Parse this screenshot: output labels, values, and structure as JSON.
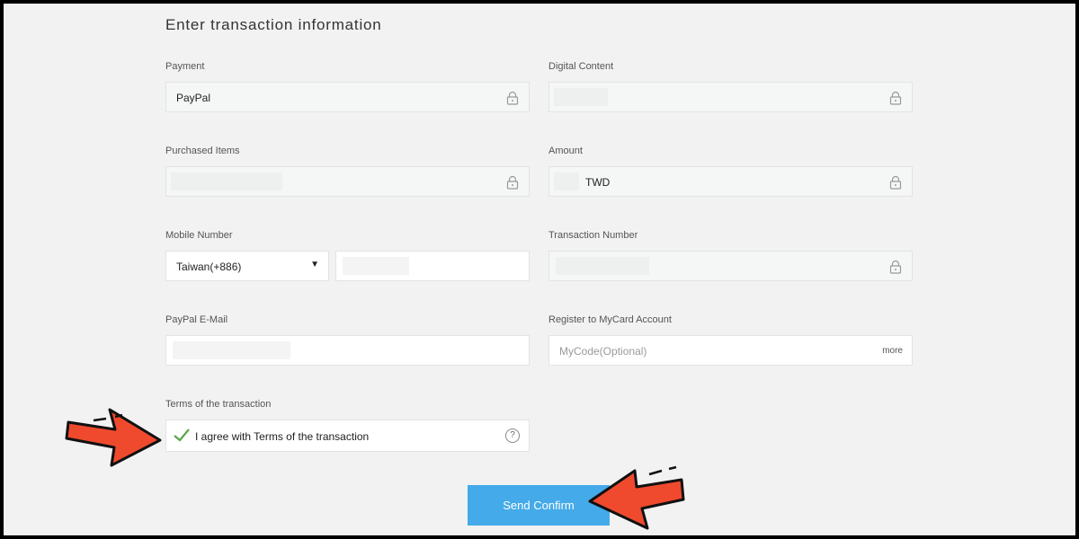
{
  "title": "Enter transaction information",
  "fields": {
    "payment": {
      "label": "Payment",
      "value": "PayPal"
    },
    "digital_content": {
      "label": "Digital Content",
      "value": ""
    },
    "purchased_items": {
      "label": "Purchased Items",
      "value": ""
    },
    "amount": {
      "label": "Amount",
      "currency": "TWD"
    },
    "mobile_number": {
      "label": "Mobile Number",
      "country": "Taiwan(+886)",
      "number": ""
    },
    "transaction_number": {
      "label": "Transaction Number",
      "value": ""
    },
    "paypal_email": {
      "label": "PayPal E-Mail",
      "value": ""
    },
    "register": {
      "label": "Register to MyCard Account",
      "placeholder": "MyCode(Optional)",
      "more": "more"
    },
    "terms": {
      "label": "Terms of the transaction",
      "text": "I agree with Terms of the transaction",
      "help": "?"
    }
  },
  "submit_label": "Send Confirm",
  "colors": {
    "button": "#44aae9",
    "arrow": "#f04a2e",
    "check": "#5aa64a"
  },
  "icons": [
    "lock-icon",
    "dropdown-caret-icon",
    "checkmark-icon",
    "help-icon",
    "arrow-icon"
  ]
}
